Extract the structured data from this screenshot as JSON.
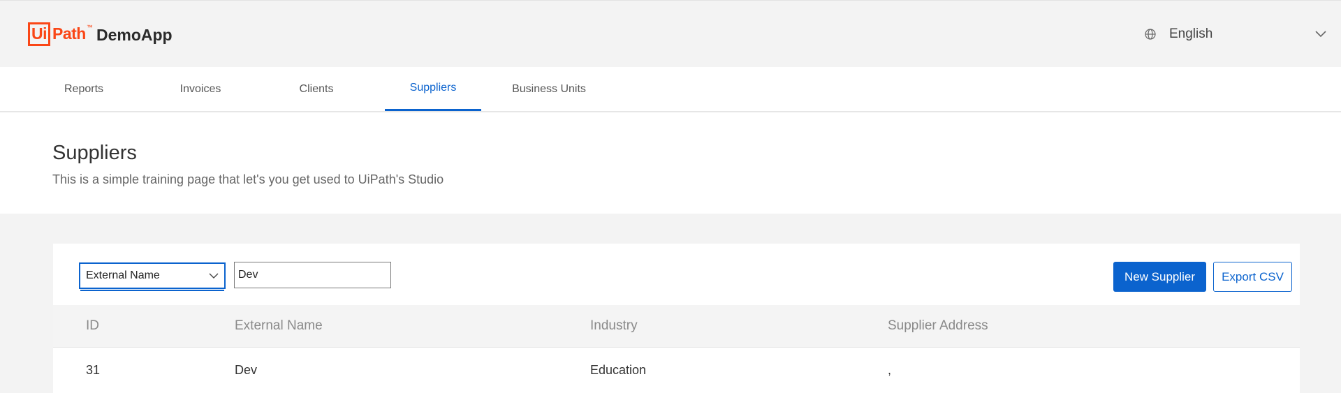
{
  "header": {
    "logo_ui": "Ui",
    "logo_path": "Path",
    "logo_tm": "™",
    "app_name": "DemoApp",
    "language": "English"
  },
  "tabs": [
    {
      "label": "Reports"
    },
    {
      "label": "Invoices"
    },
    {
      "label": "Clients"
    },
    {
      "label": "Suppliers",
      "active": true
    },
    {
      "label": "Business Units"
    }
  ],
  "page": {
    "title": "Suppliers",
    "subtitle": "This is a simple training page that let's you get used to UiPath's Studio"
  },
  "filter": {
    "field": "External Name",
    "value": "Dev"
  },
  "actions": {
    "new_label": "New Supplier",
    "export_label": "Export CSV"
  },
  "table": {
    "columns": [
      "ID",
      "External Name",
      "Industry",
      "Supplier Address"
    ],
    "rows": [
      [
        "31",
        "Dev",
        "Education",
        ","
      ]
    ]
  },
  "colors": {
    "accent": "#0b63ce",
    "brand": "#fa4616"
  }
}
